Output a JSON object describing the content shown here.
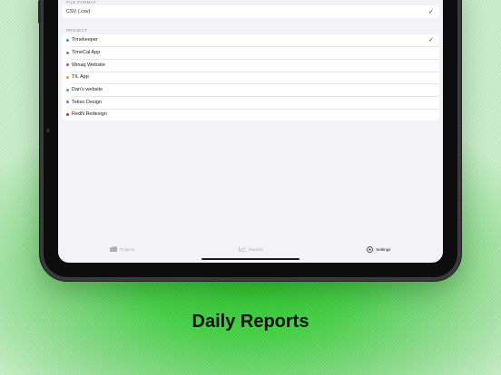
{
  "colors": {
    "background": "#46cf46",
    "screen": "#f2f2f7"
  },
  "file_format": {
    "header": "FILE FORMAT",
    "selected": "CSV (.csv)",
    "check_icon": "checkmark-icon"
  },
  "project": {
    "header": "PROJECT",
    "items": [
      {
        "label": "Timekeeper",
        "color": "#3b82f6",
        "selected": true
      },
      {
        "label": "TimeCal App",
        "color": "#a855f7",
        "selected": false
      },
      {
        "label": "Winaq Website",
        "color": "#ef4444",
        "selected": false
      },
      {
        "label": "TIL App",
        "color": "#f59e0b",
        "selected": false
      },
      {
        "label": "Dan's website",
        "color": "#22c55e",
        "selected": false
      },
      {
        "label": "Tekso Design",
        "color": "#8b5cf6",
        "selected": false
      },
      {
        "label": "RedN Redesign",
        "color": "#dc2626",
        "selected": false
      }
    ]
  },
  "tabs": [
    {
      "label": "Projects",
      "icon": "folder-icon",
      "active": false
    },
    {
      "label": "Reports",
      "icon": "chart-line-icon",
      "active": false
    },
    {
      "label": "Settings",
      "icon": "gear-icon",
      "active": true
    }
  ],
  "caption": "Daily Reports"
}
